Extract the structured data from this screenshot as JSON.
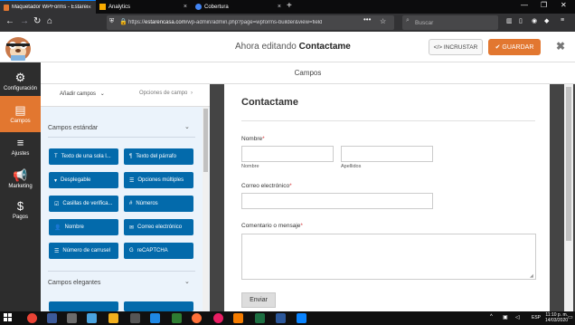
{
  "browser": {
    "tabs": [
      {
        "title": "Maquetador WPForms - Estarencasa",
        "close": "×"
      },
      {
        "title": "Analytics",
        "close": "×"
      },
      {
        "title": "Cobertura",
        "close": "×"
      }
    ],
    "new_tab": "+",
    "url_prefix": "https://",
    "url_host": "estarencasa.com",
    "url_path": "/wp-admin/admin.php?page=wpforms-builder&view=fields",
    "url_dots": "•••",
    "search_placeholder": "Buscar",
    "window_controls": [
      "—",
      "❐",
      "✕"
    ]
  },
  "header": {
    "editing_prefix": "Ahora editando",
    "form_name": "Contactame",
    "embed_label": "</> INCRUSTAR",
    "save_label": "✔ GUARDAR",
    "close_label": "✖"
  },
  "sidebar": {
    "items": [
      {
        "label": "Configuración",
        "icon": "⚙"
      },
      {
        "label": "Campos",
        "icon": "▤"
      },
      {
        "label": "Ajustes",
        "icon": "≡"
      },
      {
        "label": "Marketing",
        "icon": "📢"
      },
      {
        "label": "Pagos",
        "icon": "$"
      }
    ]
  },
  "section_title": "Campos",
  "panel": {
    "tab_add": "Añadir campos",
    "tab_add_chevron": "⌄",
    "tab_options": "Opciones de campo",
    "tab_options_chevron": "›",
    "group_standard": "Campos estándar",
    "group_fancy": "Campos elegantes",
    "group_chevron": "⌄",
    "standard_fields": [
      {
        "icon": "T",
        "label": "Texto de una sola l..."
      },
      {
        "icon": "¶",
        "label": "Texto del párrafo"
      },
      {
        "icon": "▾",
        "label": "Desplegable"
      },
      {
        "icon": "☰",
        "label": "Opciones múltiples"
      },
      {
        "icon": "☑",
        "label": "Casillas de verifica..."
      },
      {
        "icon": "#",
        "label": "Números"
      },
      {
        "icon": "👤",
        "label": "Nombre"
      },
      {
        "icon": "✉",
        "label": "Correo electrónico"
      },
      {
        "icon": "☰",
        "label": "Número de carrusel"
      },
      {
        "icon": "G",
        "label": "reCAPTCHA"
      }
    ]
  },
  "form": {
    "title": "Contactame",
    "name_label": "Nombre",
    "required_mark": "*",
    "first_sublabel": "Nombre",
    "last_sublabel": "Apellidos",
    "email_label": "Correo electrónico",
    "comment_label": "Comentario o mensaje",
    "submit_label": "Enviar"
  },
  "taskbar": {
    "lang": "ESP",
    "time": "11:10 p. m.",
    "date": "14/03/2020"
  },
  "colors": {
    "accent": "#e27730",
    "field_button": "#036aab",
    "sidebar": "#2d2d2d"
  }
}
